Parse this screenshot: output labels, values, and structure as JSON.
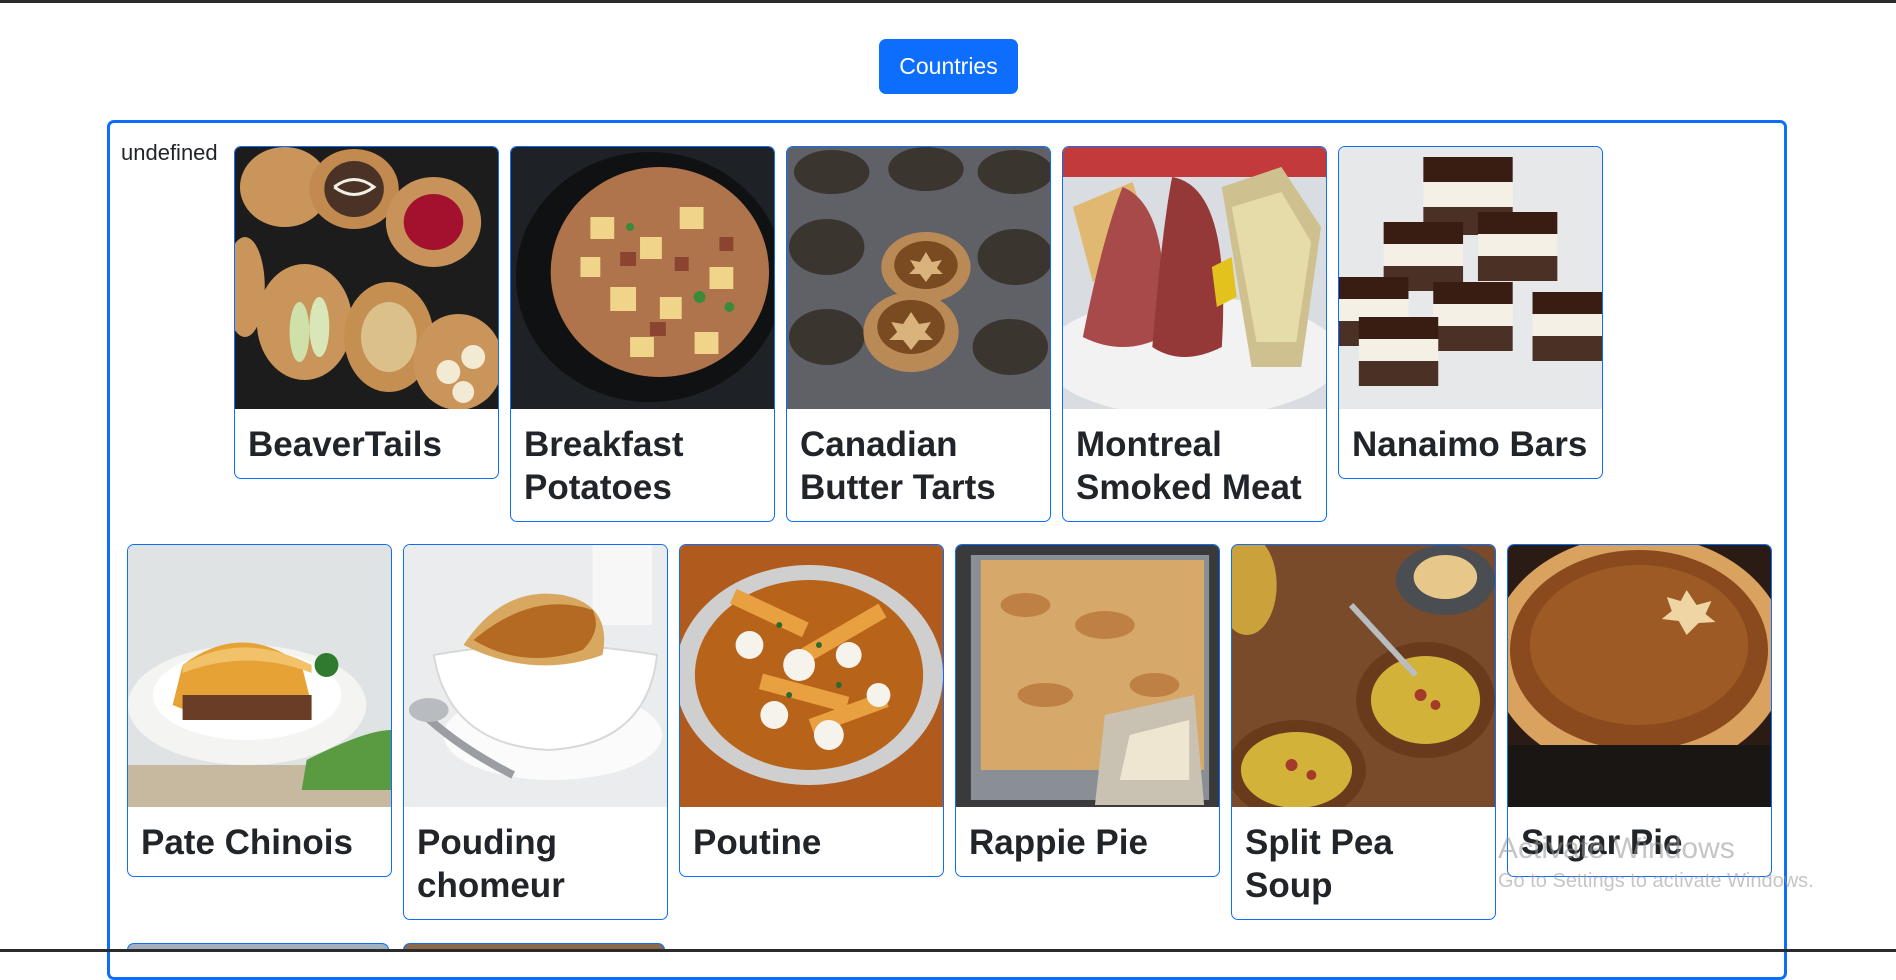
{
  "header": {
    "countries_button": "Countries"
  },
  "panel": {
    "heading": "undefined"
  },
  "dishes": [
    {
      "name": "BeaverTails"
    },
    {
      "name": "Breakfast Potatoes"
    },
    {
      "name": "Canadian Butter Tarts"
    },
    {
      "name": "Montreal Smoked Meat"
    },
    {
      "name": "Nanaimo Bars"
    },
    {
      "name": "Pate Chinois"
    },
    {
      "name": "Pouding chomeur"
    },
    {
      "name": "Poutine"
    },
    {
      "name": "Rappie Pie"
    },
    {
      "name": "Split Pea Soup"
    },
    {
      "name": "Sugar Pie"
    }
  ],
  "watermark": {
    "line1": "Activate Windows",
    "line2": "Go to Settings to activate Windows."
  },
  "colors": {
    "accent": "#0d6efd",
    "text": "#212529"
  }
}
